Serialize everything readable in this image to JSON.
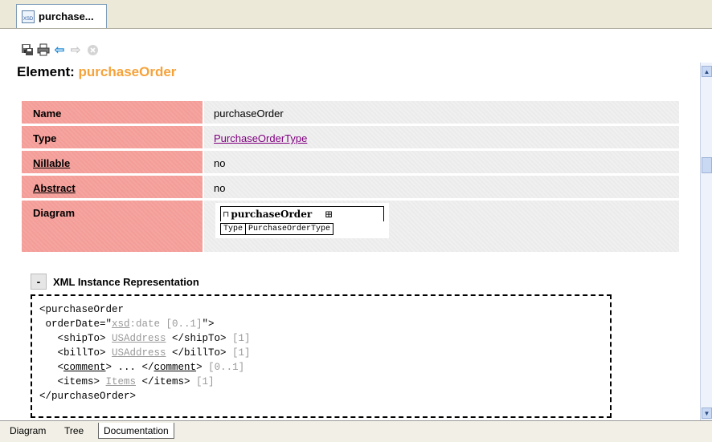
{
  "document_tab": {
    "label": "purchase...",
    "icon": "xsd-file-icon",
    "icon_text": "XSD"
  },
  "toolbar": {
    "buttons": [
      {
        "name": "save-icon"
      },
      {
        "name": "print-icon"
      },
      {
        "name": "back-arrow-icon",
        "glyph": "⇦"
      },
      {
        "name": "forward-arrow-icon",
        "glyph": "⇨"
      },
      {
        "name": "stop-icon"
      }
    ]
  },
  "heading": {
    "prefix": "Element: ",
    "name": "purchaseOrder",
    "name_color": "#f6a23a"
  },
  "properties": {
    "name_key": "Name",
    "name_val": "purchaseOrder",
    "type_key": "Type",
    "type_val": "PurchaseOrderType",
    "nillable_key": "Nillable",
    "nillable_val": "no",
    "abstract_key": "Abstract",
    "abstract_val": "no",
    "diagram_key": "Diagram"
  },
  "diagram": {
    "element_name": "purchaseOrder",
    "element_icon_glyph": "⊓",
    "plus_glyph": "⊞",
    "attr_label": "Type",
    "attr_value": "PurchaseOrderType"
  },
  "xml_instance": {
    "collapse_label": "-",
    "title": "XML Instance Representation",
    "l1": "<purchaseOrder",
    "l2_a": " orderDate=\"",
    "l2_b": "xsd",
    "l2_c": ":date [0..1]",
    "l2_d": "\">",
    "l3_a": "   <shipTo> ",
    "l3_b": "USAddress",
    "l3_c": " </shipTo> ",
    "l3_d": "[1]",
    "l4_a": "   <billTo> ",
    "l4_b": "USAddress",
    "l4_c": " </billTo> ",
    "l4_d": "[1]",
    "l5_a": "   <",
    "l5_b": "comment",
    "l5_c": "> ... </",
    "l5_d": "comment",
    "l5_e": "> ",
    "l5_f": "[0..1]",
    "l6_a": "   <items> ",
    "l6_b": "Items",
    "l6_c": " </items> ",
    "l6_d": "[1]",
    "l7": "</purchaseOrder>"
  },
  "scrollbar": {
    "up_glyph": "▲",
    "down_glyph": "▼"
  },
  "bottom_tabs": {
    "diagram": "Diagram",
    "tree": "Tree",
    "documentation": "Documentation",
    "active": "Documentation"
  }
}
